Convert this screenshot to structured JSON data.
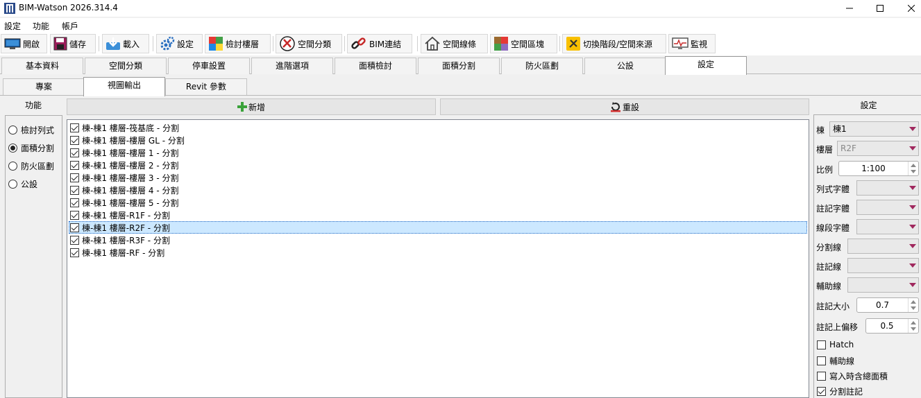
{
  "window": {
    "title": "BIM-Watson 2026.314.4"
  },
  "menu": [
    "設定",
    "功能",
    "帳戶"
  ],
  "toolbar": {
    "buttons": [
      {
        "label": "開啟",
        "icon": "monitor-open-icon"
      },
      {
        "label": "儲存",
        "icon": "floppy-save-icon"
      },
      {
        "label": "載入",
        "icon": "download-load-icon"
      },
      {
        "label": "設定",
        "icon": "gears-settings-icon"
      },
      {
        "label": "檢討樓層",
        "icon": "puzzle-icon"
      },
      {
        "label": "空間分類",
        "icon": "tools-classify-icon"
      },
      {
        "label": "BIM連結",
        "icon": "chain-link-icon"
      },
      {
        "label": "空間線條",
        "icon": "house-outline-icon"
      },
      {
        "label": "空間區塊",
        "icon": "color-blocks-icon"
      },
      {
        "label": "切換階段/空間來源",
        "icon": "switch-phase-icon"
      },
      {
        "label": "監視",
        "icon": "monitor-watch-icon"
      }
    ]
  },
  "main_tabs": [
    "基本資料",
    "空間分類",
    "停車設置",
    "進階選項",
    "面積檢討",
    "面積分割",
    "防火區劃",
    "公設",
    "設定"
  ],
  "sub_tabs": [
    "專案",
    "視圖輸出",
    "Revit 參數"
  ],
  "left_panel": {
    "title": "功能",
    "options": [
      {
        "label": "檢討列式",
        "selected": false
      },
      {
        "label": "面積分割",
        "selected": true
      },
      {
        "label": "防火區劃",
        "selected": false
      },
      {
        "label": "公設",
        "selected": false
      }
    ]
  },
  "actions": {
    "add_label": "新增",
    "reset_label": "重設"
  },
  "list_items": [
    {
      "text": "棟-棟1 樓層-筏基底 - 分割",
      "checked": true
    },
    {
      "text": "棟-棟1 樓層-樓層 GL - 分割",
      "checked": true
    },
    {
      "text": "棟-棟1 樓層-樓層 1 - 分割",
      "checked": true
    },
    {
      "text": "棟-棟1 樓層-樓層 2 - 分割",
      "checked": true
    },
    {
      "text": "棟-棟1 樓層-樓層 3 - 分割",
      "checked": true
    },
    {
      "text": "棟-棟1 樓層-樓層 4 - 分割",
      "checked": true
    },
    {
      "text": "棟-棟1 樓層-樓層 5 - 分割",
      "checked": true
    },
    {
      "text": "棟-棟1 樓層-R1F - 分割",
      "checked": true
    },
    {
      "text": "棟-棟1 樓層-R2F - 分割",
      "checked": true,
      "selected": true
    },
    {
      "text": "棟-棟1 樓層-R3F - 分割",
      "checked": true
    },
    {
      "text": "棟-棟1 樓層-RF - 分割",
      "checked": true
    }
  ],
  "settings": {
    "title": "設定",
    "building_label": "棟",
    "building_value": "棟1",
    "floor_label": "樓層",
    "floor_value": "R2F",
    "scale_label": "比例",
    "scale_value": "1:100",
    "column_font_label": "列式字體",
    "annotation_font_label": "註記字體",
    "segment_font_label": "線段字體",
    "split_line_label": "分割線",
    "annotation_line_label": "註記線",
    "aux_line_label": "輔助線",
    "annotation_size_label": "註記大小",
    "annotation_size_value": "0.7",
    "annotation_offset_label": "註記上偏移",
    "annotation_offset_value": "0.5",
    "checks": [
      {
        "label": "Hatch",
        "checked": false
      },
      {
        "label": "輔助線",
        "checked": false
      },
      {
        "label": "寫入時含總面積",
        "checked": false
      },
      {
        "label": "分割註記",
        "checked": true
      }
    ]
  }
}
